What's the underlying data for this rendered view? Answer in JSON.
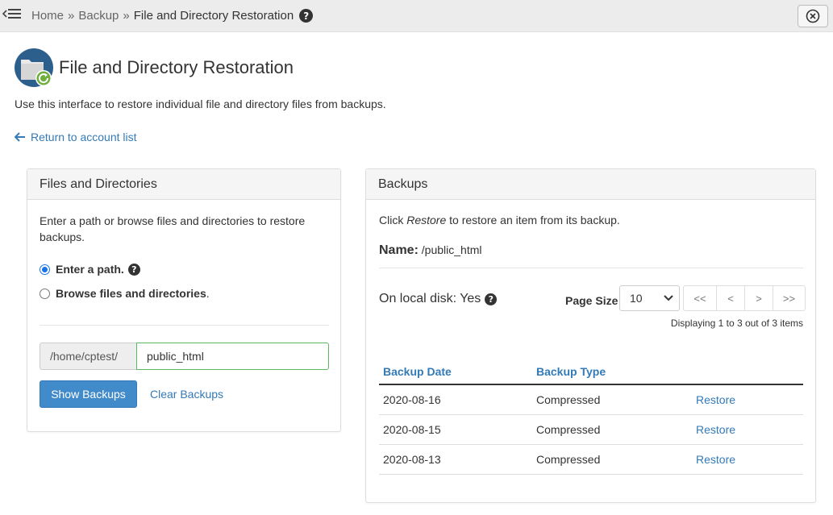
{
  "breadcrumb": {
    "home": "Home",
    "backup": "Backup",
    "current": "File and Directory Restoration",
    "separator": "»"
  },
  "header": {
    "title": "File and Directory Restoration",
    "description": "Use this interface to restore individual file and directory files from backups.",
    "return_link": "Return to account list"
  },
  "files_panel": {
    "title": "Files and Directories",
    "instructions": "Enter a path or browse files and directories to restore backups.",
    "option_enter_path": "Enter a path.",
    "option_browse": "Browse files and directories",
    "option_browse_suffix": ".",
    "path_prefix": "/home/cptest/",
    "path_value": "public_html",
    "show_backups_label": "Show Backups",
    "clear_backups_label": "Clear Backups"
  },
  "backups_panel": {
    "title": "Backups",
    "instr_before": "Click ",
    "instr_em": "Restore",
    "instr_after": " to restore an item from its backup.",
    "name_label": "Name:",
    "name_value": " /public_html",
    "local_disk": "On local disk: Yes",
    "page_size_label": "Page Size",
    "page_size_value": "10",
    "pager": {
      "first": "<<",
      "prev": "<",
      "next": ">",
      "last": ">>"
    },
    "display_count": "Displaying 1 to 3 out of 3 items",
    "columns": {
      "date": "Backup Date",
      "type": "Backup Type"
    },
    "rows": [
      {
        "date": "2020-08-16",
        "type": "Compressed",
        "action": "Restore"
      },
      {
        "date": "2020-08-15",
        "type": "Compressed",
        "action": "Restore"
      },
      {
        "date": "2020-08-13",
        "type": "Compressed",
        "action": "Restore"
      }
    ]
  },
  "icons": {
    "menu": "menu-collapse-icon",
    "help": "question-circle-icon",
    "close": "close-icon",
    "page": "folder-restore-icon",
    "return": "arrow-left-icon"
  },
  "colors": {
    "link": "#337ab7",
    "primary_button": "#428bca",
    "input_valid_border": "#5cb85c",
    "radio_accent": "#1a73e8"
  }
}
